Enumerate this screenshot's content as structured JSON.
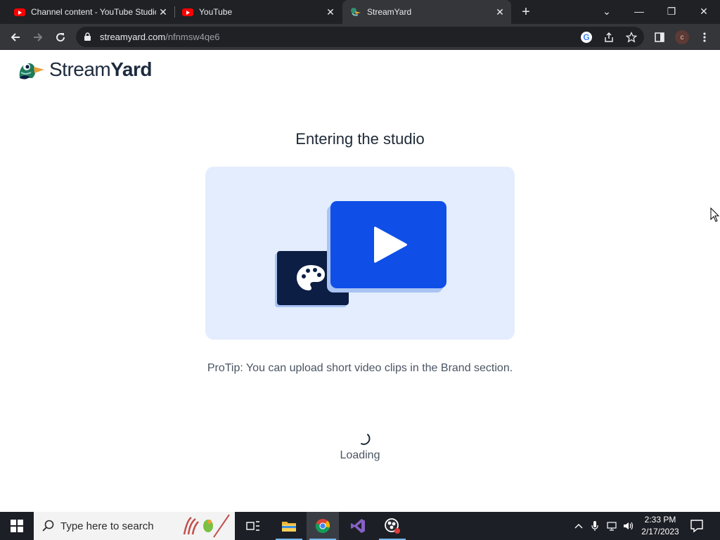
{
  "browser": {
    "tabs": [
      {
        "title": "Channel content - YouTube Studio",
        "favicon": "youtube-icon",
        "active": false
      },
      {
        "title": "YouTube",
        "favicon": "youtube-icon",
        "active": false
      },
      {
        "title": "StreamYard",
        "favicon": "streamyard-icon",
        "active": true
      }
    ],
    "url_domain": "streamyard.com",
    "url_path": "/nfnmsw4qe6",
    "profile_initial": "c"
  },
  "page": {
    "brand_light": "Stream",
    "brand_bold": "Yard",
    "title": "Entering the studio",
    "protip": "ProTip: You can upload short video clips in the Brand section.",
    "loading_text": "Loading"
  },
  "taskbar": {
    "search_placeholder": "Type here to search",
    "time": "2:33 PM",
    "date": "2/17/2023"
  },
  "colors": {
    "accent_blue": "#0f4fe8",
    "navy": "#0d1e44",
    "illustration_bg": "#e3edfd"
  }
}
